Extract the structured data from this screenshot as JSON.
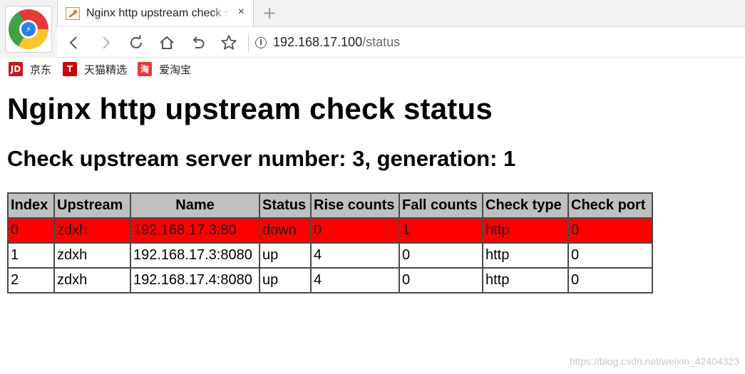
{
  "browser": {
    "tab": {
      "title": "Nginx http upstream check status",
      "close_glyph": "×"
    },
    "new_tab_glyph": "+",
    "address_bar": {
      "host": "192.168.17.100",
      "path": "/status"
    },
    "bookmarks": [
      {
        "icon": "JD",
        "label": "京东",
        "color": "#c9151e"
      },
      {
        "icon": "T",
        "label": "天猫精选",
        "color": "#cc0000"
      },
      {
        "icon": "淘",
        "label": "爱淘宝",
        "color": "#e4393c"
      }
    ]
  },
  "page": {
    "title": "Nginx http upstream check status",
    "subtitle": "Check upstream server number: 3, generation: 1",
    "table": {
      "headers": [
        "Index",
        "Upstream",
        "Name",
        "Status",
        "Rise counts",
        "Fall counts",
        "Check type",
        "Check port"
      ],
      "rows": [
        {
          "index": "0",
          "upstream": "zdxh",
          "name": "192.168.17.3:80",
          "status": "down",
          "rise": "0",
          "fall": "1",
          "type": "http",
          "port": "0"
        },
        {
          "index": "1",
          "upstream": "zdxh",
          "name": "192.168.17.3:8080",
          "status": "up",
          "rise": "4",
          "fall": "0",
          "type": "http",
          "port": "0"
        },
        {
          "index": "2",
          "upstream": "zdxh",
          "name": "192.168.17.4:8080",
          "status": "up",
          "rise": "4",
          "fall": "0",
          "type": "http",
          "port": "0"
        }
      ],
      "colors": {
        "header_bg": "#c0c0c0",
        "down_row_bg": "#ff0000"
      }
    }
  },
  "watermark": "https://blog.csdn.net/weixin_42404323"
}
